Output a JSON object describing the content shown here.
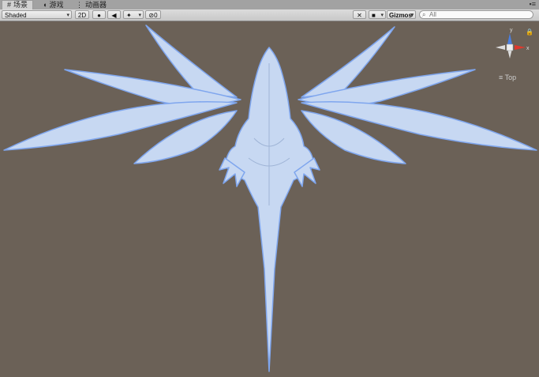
{
  "tabs": [
    {
      "label": "场景",
      "icon": "hash-icon"
    },
    {
      "label": "游戏",
      "icon": "pacman-icon"
    },
    {
      "label": "动画器",
      "icon": "animator-icon"
    }
  ],
  "toolbar": {
    "shading_mode": "Shaded",
    "mode_2d": "2D",
    "hidden_count": "0",
    "gizmos_label": "Gizmos",
    "search_placeholder": "All"
  },
  "scene": {
    "orientation_label": "Top",
    "axis_y": "y",
    "axis_x": "x",
    "colors": {
      "background": "#6b6157",
      "model": "#c7d8f2",
      "outline": "#7fa6ee"
    }
  }
}
